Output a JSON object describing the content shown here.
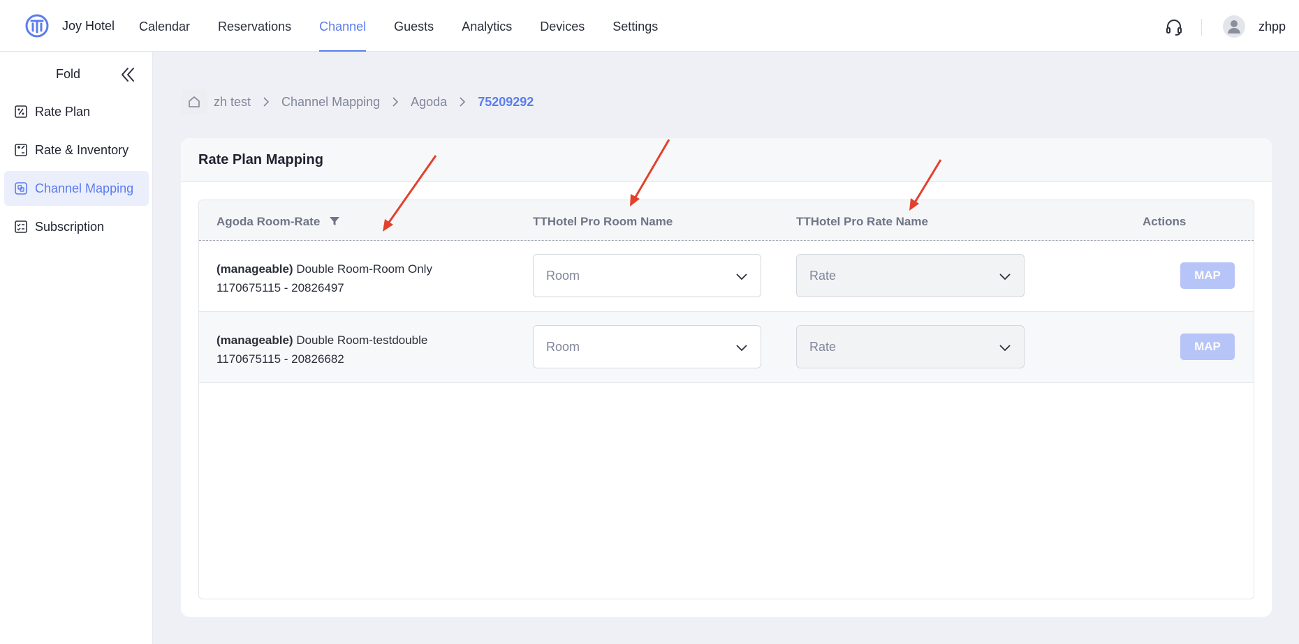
{
  "app": {
    "hotel_name": "Joy Hotel",
    "user": "zhpp",
    "accent_color": "#5b7cf0"
  },
  "nav": {
    "items": [
      {
        "label": "Calendar",
        "active": false
      },
      {
        "label": "Reservations",
        "active": false
      },
      {
        "label": "Channel",
        "active": true
      },
      {
        "label": "Guests",
        "active": false
      },
      {
        "label": "Analytics",
        "active": false
      },
      {
        "label": "Devices",
        "active": false
      },
      {
        "label": "Settings",
        "active": false
      }
    ]
  },
  "sidebar": {
    "fold_label": "Fold",
    "items": [
      {
        "label": "Rate Plan",
        "icon": "rate-plan-icon",
        "active": false
      },
      {
        "label": "Rate & Inventory",
        "icon": "rate-inventory-icon",
        "active": false
      },
      {
        "label": "Channel Mapping",
        "icon": "channel-mapping-icon",
        "active": true
      },
      {
        "label": "Subscription",
        "icon": "subscription-icon",
        "active": false
      }
    ]
  },
  "breadcrumb": {
    "items": [
      "zh test",
      "Channel Mapping",
      "Agoda"
    ],
    "current": "75209292"
  },
  "card": {
    "title": "Rate Plan Mapping"
  },
  "table": {
    "headers": {
      "channel_room_rate": "Agoda Room-Rate",
      "room_name": "TTHotel Pro Room Name",
      "rate_name": "TTHotel Pro Rate Name",
      "actions": "Actions"
    },
    "rows": [
      {
        "tag": "(manageable)",
        "name": " Double Room-Room Only",
        "ids": "1170675115 - 20826497",
        "room_placeholder": "Room",
        "rate_placeholder": "Rate",
        "action": "MAP"
      },
      {
        "tag": "(manageable)",
        "name": " Double Room-testdouble",
        "ids": "1170675115 - 20826682",
        "room_placeholder": "Room",
        "rate_placeholder": "Rate",
        "action": "MAP"
      }
    ]
  }
}
